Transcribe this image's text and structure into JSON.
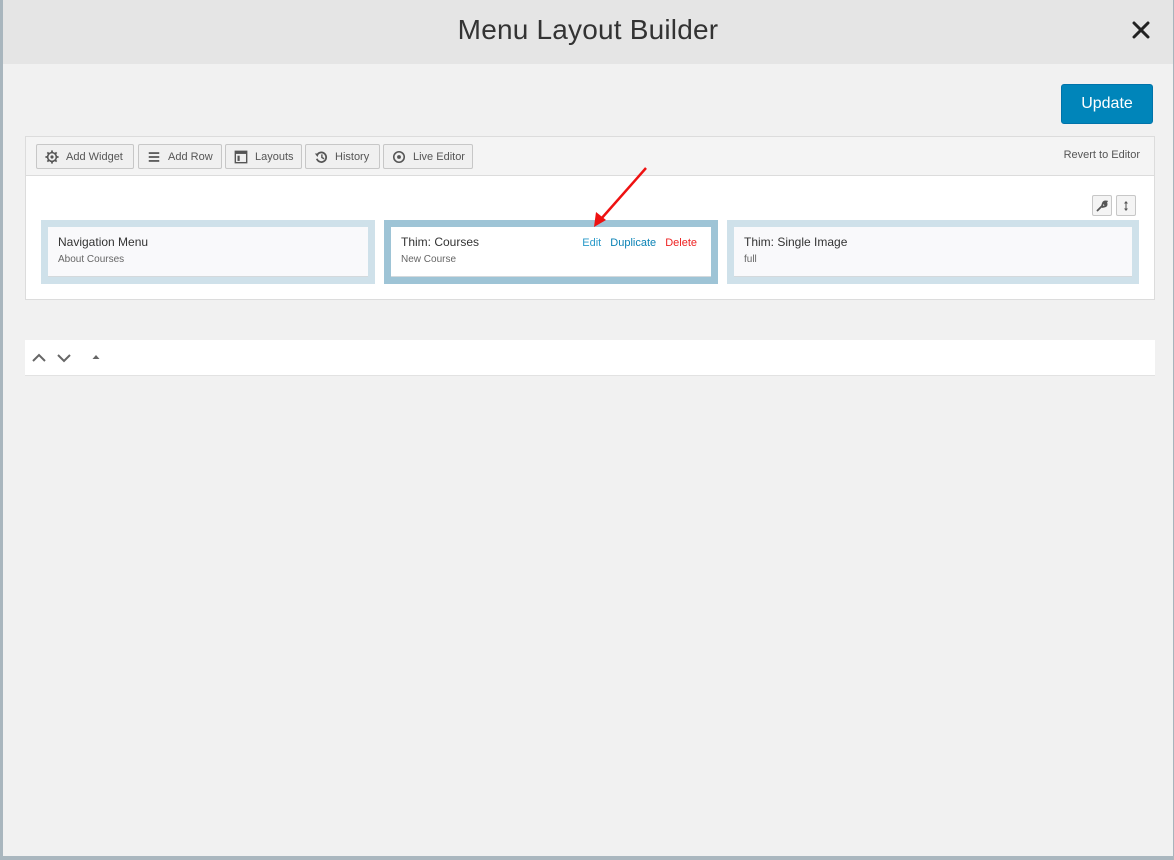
{
  "modal": {
    "title": "Menu Layout Builder",
    "close_icon": "close-icon",
    "update_label": "Update"
  },
  "toolbar": {
    "buttons": [
      {
        "label": "Add Widget",
        "icon": "gear-icon"
      },
      {
        "label": "Add Row",
        "icon": "menu-lines-icon"
      },
      {
        "label": "Layouts",
        "icon": "layout-icon"
      },
      {
        "label": "History",
        "icon": "history-icon"
      },
      {
        "label": "Live Editor",
        "icon": "eye-icon"
      }
    ],
    "revert_label": "Revert to Editor"
  },
  "row_tools": {
    "settings_icon": "wrench-icon",
    "move_icon": "move-vertical-icon"
  },
  "widgets": [
    {
      "title": "Navigation Menu",
      "description": "About Courses",
      "active": false
    },
    {
      "title": "Thim: Courses",
      "description": "New Course",
      "active": true,
      "actions": {
        "edit": "Edit",
        "duplicate": "Duplicate",
        "delete": "Delete"
      }
    },
    {
      "title": "Thim: Single Image",
      "description": "full",
      "active": false
    }
  ],
  "bottom_bar": {
    "icons": [
      "chevron-up-icon",
      "chevron-down-icon",
      "triangle-up-icon"
    ]
  },
  "annotation": {
    "color": "#ff0000",
    "points_to": "Edit"
  },
  "colors": {
    "accent": "#0085ba",
    "delete": "#ee2222",
    "link": "#0a82b5"
  }
}
